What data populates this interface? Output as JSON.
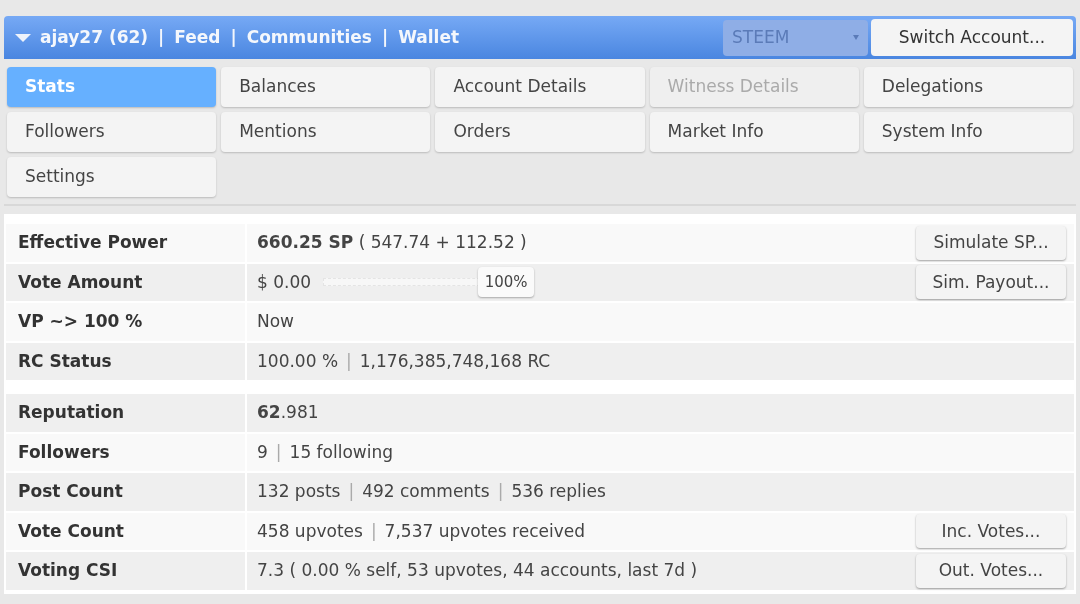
{
  "header": {
    "links": [
      "ajay27 (62)",
      "Feed",
      "Communities",
      "Wallet"
    ],
    "separator": "|",
    "currency_select": {
      "value": "STEEM",
      "disabled": true
    },
    "switch_button": "Switch Account..."
  },
  "tabs": [
    {
      "label": "Stats",
      "selected": true,
      "disabled": false
    },
    {
      "label": "Balances",
      "selected": false,
      "disabled": false
    },
    {
      "label": "Account Details",
      "selected": false,
      "disabled": false
    },
    {
      "label": "Witness Details",
      "selected": false,
      "disabled": true
    },
    {
      "label": "Delegations",
      "selected": false,
      "disabled": false
    },
    {
      "label": "Followers",
      "selected": false,
      "disabled": false
    },
    {
      "label": "Mentions",
      "selected": false,
      "disabled": false
    },
    {
      "label": "Orders",
      "selected": false,
      "disabled": false
    },
    {
      "label": "Market Info",
      "selected": false,
      "disabled": false
    },
    {
      "label": "System Info",
      "selected": false,
      "disabled": false
    },
    {
      "label": "Settings",
      "selected": false,
      "disabled": false
    }
  ],
  "stats": {
    "separator": "|",
    "groups": [
      [
        {
          "label": "Effective Power",
          "parts": [
            "**660.25 SP** ( 547.74 + 112.52 )"
          ],
          "button": "Simulate SP..."
        },
        {
          "label": "Vote Amount",
          "parts": [
            "$ 0.00"
          ],
          "slider": {
            "level": 1,
            "reading": "100%"
          },
          "button": "Sim. Payout..."
        },
        {
          "label": "VP ~> 100 %",
          "parts": [
            "Now"
          ]
        },
        {
          "label": "RC Status",
          "parts": [
            "100.00 %",
            "1,176,385,748,168 RC"
          ]
        }
      ],
      [
        {
          "label": "Reputation",
          "parts": [
            "**62**.981"
          ]
        },
        {
          "label": "Followers",
          "parts": [
            "9",
            "15 following"
          ]
        },
        {
          "label": "Post Count",
          "parts": [
            "132 posts",
            "492 comments",
            "536 replies"
          ]
        },
        {
          "label": "Vote Count",
          "parts": [
            "458 upvotes",
            "7,537 upvotes received"
          ],
          "button": "Inc. Votes..."
        },
        {
          "label": "Voting CSI",
          "parts": [
            "7.3 ( 0.00 % self, 53 upvotes, 44 accounts, last 7d )"
          ],
          "button": "Out. Votes..."
        }
      ]
    ]
  }
}
